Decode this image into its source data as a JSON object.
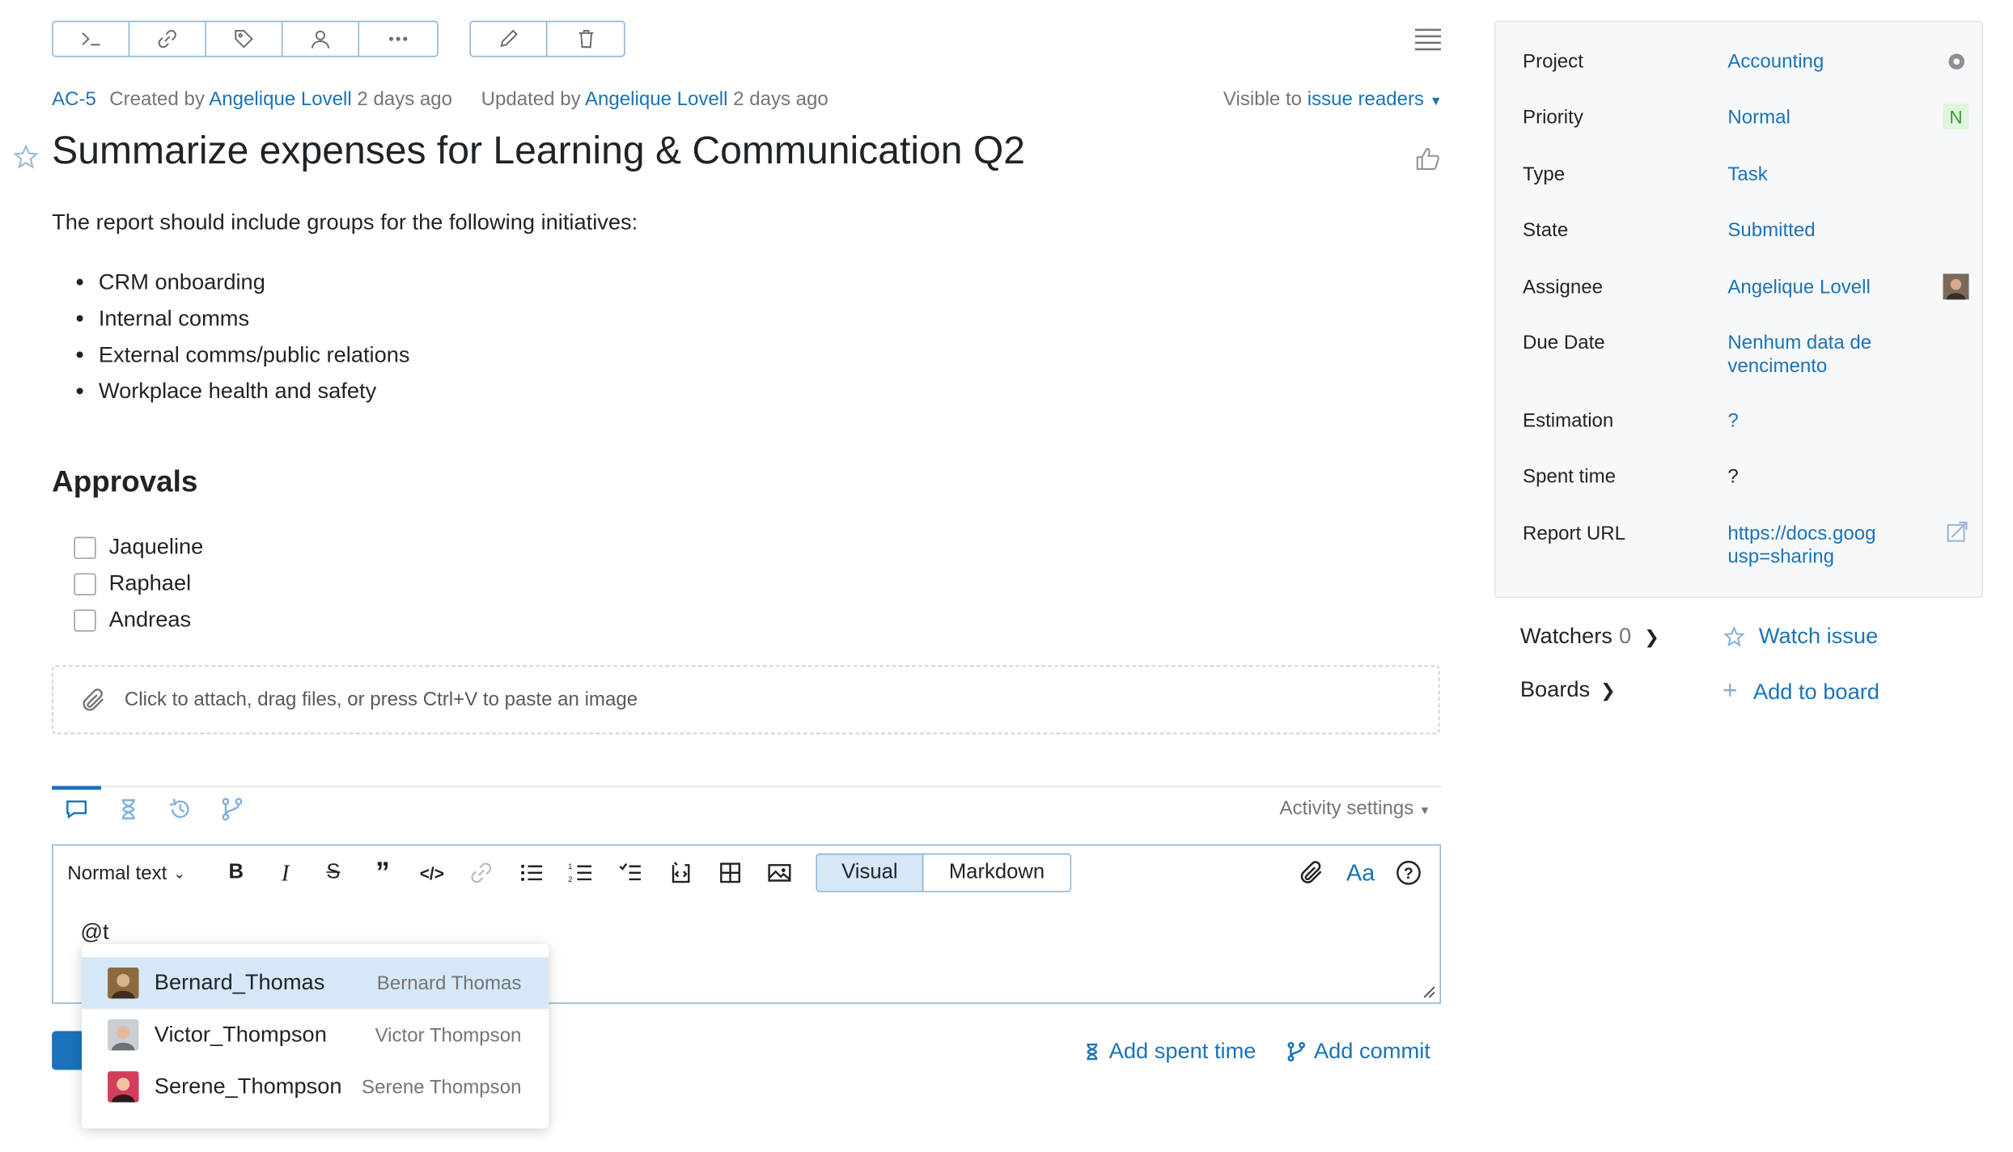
{
  "toolbar": {
    "group1": [
      "command-icon",
      "link-icon",
      "tag-icon",
      "user-icon",
      "more-icon"
    ],
    "group2": [
      "pencil-icon",
      "trash-icon"
    ]
  },
  "issue": {
    "id": "AC-5",
    "created_prefix": "Created by",
    "created_by": "Angelique Lovell",
    "created_ago": "2 days ago",
    "updated_prefix": "Updated by",
    "updated_by": "Angelique Lovell",
    "updated_ago": "2 days ago",
    "visible_prefix": "Visible to",
    "visible_to": "issue readers",
    "title": "Summarize expenses for Learning & Communication Q2",
    "description": "The report should include groups for the following initiatives:",
    "initiatives": [
      "CRM onboarding",
      "Internal comms",
      "External comms/public relations",
      "Workplace health and safety"
    ],
    "approvals_heading": "Approvals",
    "approvals": [
      {
        "label": "Jaqueline",
        "checked": false
      },
      {
        "label": "Raphael",
        "checked": false
      },
      {
        "label": "Andreas",
        "checked": false
      }
    ],
    "attach_hint": "Click to attach, drag files, or press Ctrl+V to paste an image"
  },
  "activity": {
    "settings_label": "Activity settings"
  },
  "editor": {
    "format_select": "Normal text",
    "mode_visual": "Visual",
    "mode_markdown": "Markdown",
    "font_label": "Aa",
    "content": "@t",
    "mentions": [
      {
        "login": "Bernard_Thomas",
        "name": "Bernard Thomas",
        "selected": true
      },
      {
        "login": "Victor_Thompson",
        "name": "Victor Thompson",
        "selected": false
      },
      {
        "login": "Serene_Thompson",
        "name": "Serene Thompson",
        "selected": false
      }
    ],
    "add_spent_time": "Add spent time",
    "add_commit": "Add commit"
  },
  "fields": {
    "project": {
      "label": "Project",
      "value": "Accounting"
    },
    "priority": {
      "label": "Priority",
      "value": "Normal",
      "badge": "N"
    },
    "type": {
      "label": "Type",
      "value": "Task"
    },
    "state": {
      "label": "State",
      "value": "Submitted"
    },
    "assignee": {
      "label": "Assignee",
      "value": "Angelique Lovell"
    },
    "due_date": {
      "label": "Due Date",
      "value_line1": "Nenhum data de",
      "value_line2": "vencimento"
    },
    "estimation": {
      "label": "Estimation",
      "value": "?"
    },
    "spent_time": {
      "label": "Spent time",
      "value": "?"
    },
    "report_url": {
      "label": "Report URL",
      "value_line1": "https://docs.goog",
      "value_line2": "usp=sharing"
    }
  },
  "sidebar": {
    "watchers_label": "Watchers",
    "watchers_count": "0",
    "watch_issue": "Watch issue",
    "boards_label": "Boards",
    "add_to_board": "Add to board"
  },
  "colors": {
    "accent": "#1a73b8",
    "priority_badge_bg": "#dff5dd",
    "priority_badge_fg": "#3a9a3a"
  }
}
